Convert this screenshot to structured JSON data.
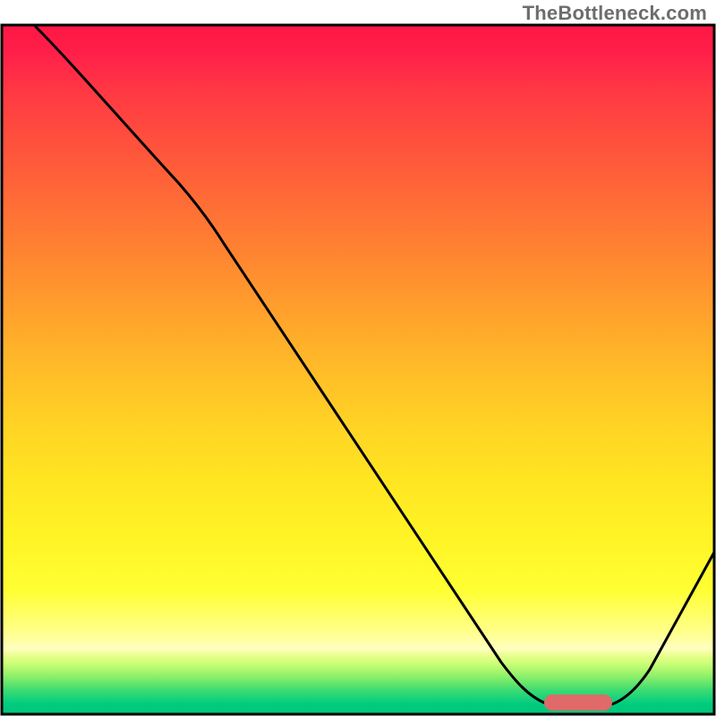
{
  "watermark": "TheBottleneck.com",
  "chart_data": {
    "type": "line",
    "title": "",
    "xlabel": "",
    "ylabel": "",
    "xlim": [
      0,
      100
    ],
    "ylim": [
      0,
      100
    ],
    "series": [
      {
        "name": "bottleneck-curve",
        "x": [
          4,
          10,
          18,
          25,
          31,
          40,
          50,
          60,
          70,
          76,
          80,
          84,
          86,
          90,
          95,
          100
        ],
        "y": [
          100,
          95,
          86,
          77,
          68,
          55,
          41,
          27,
          13,
          5,
          1,
          0,
          1,
          6,
          14,
          23
        ]
      }
    ],
    "annotations": [
      {
        "name": "optimal-marker",
        "shape": "rounded-rect",
        "x_range": [
          76,
          85
        ],
        "y": 1,
        "color": "#e06a6a"
      }
    ],
    "background_gradient": {
      "direction": "vertical",
      "stops": [
        {
          "pos": 0.0,
          "color": "#ff1744"
        },
        {
          "pos": 0.5,
          "color": "#ffbc28"
        },
        {
          "pos": 0.82,
          "color": "#ffff33"
        },
        {
          "pos": 0.9,
          "color": "#ffffc0"
        },
        {
          "pos": 0.985,
          "color": "#00cc7e"
        }
      ]
    }
  }
}
